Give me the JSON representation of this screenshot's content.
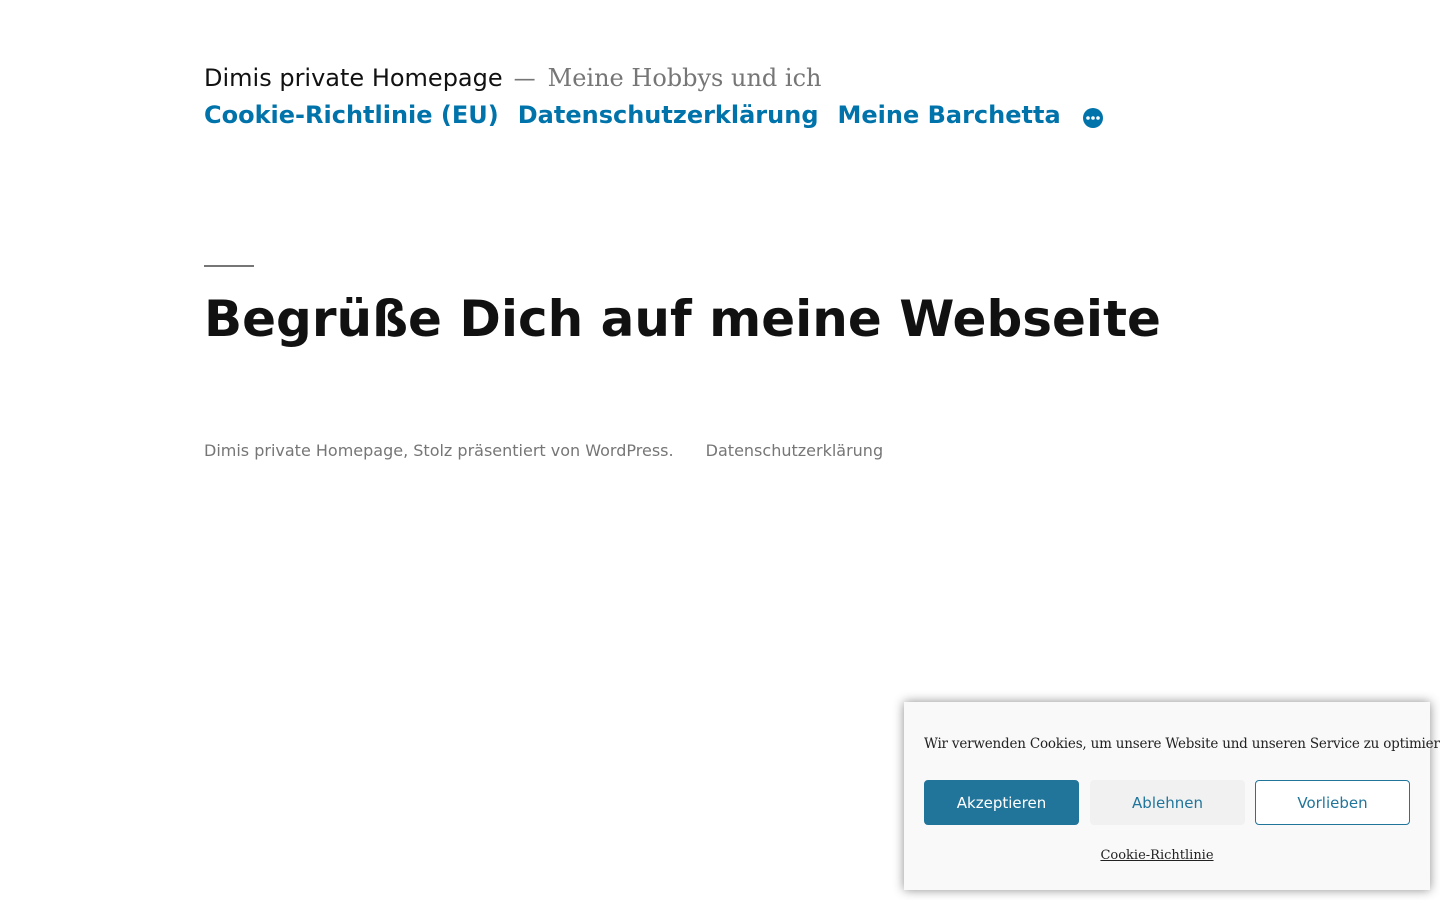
{
  "header": {
    "site_title": "Dimis private Homepage",
    "separator": "—",
    "site_description": "Meine Hobbys und ich",
    "nav_items": [
      {
        "label": "Cookie-Richtlinie (EU)"
      },
      {
        "label": "Datenschutzerklärung"
      },
      {
        "label": "Meine Barchetta"
      }
    ],
    "more_icon": "ellipsis-circle-icon"
  },
  "main": {
    "page_title": "Begrüße Dich auf meine Webseite"
  },
  "footer": {
    "site_info": "Dimis private Homepage, Stolz präsentiert von WordPress.",
    "privacy_link": "Datenschutzerklärung"
  },
  "cookie_banner": {
    "message": "Wir verwenden Cookies, um unsere Website und unseren Service zu optimieren.",
    "accept_label": "Akzeptieren",
    "deny_label": "Ablehnen",
    "preferences_label": "Vorlieben",
    "policy_link": "Cookie-Richtlinie"
  },
  "colors": {
    "link": "#0073aa",
    "accent_button": "#21759b",
    "muted_text": "#767676"
  }
}
